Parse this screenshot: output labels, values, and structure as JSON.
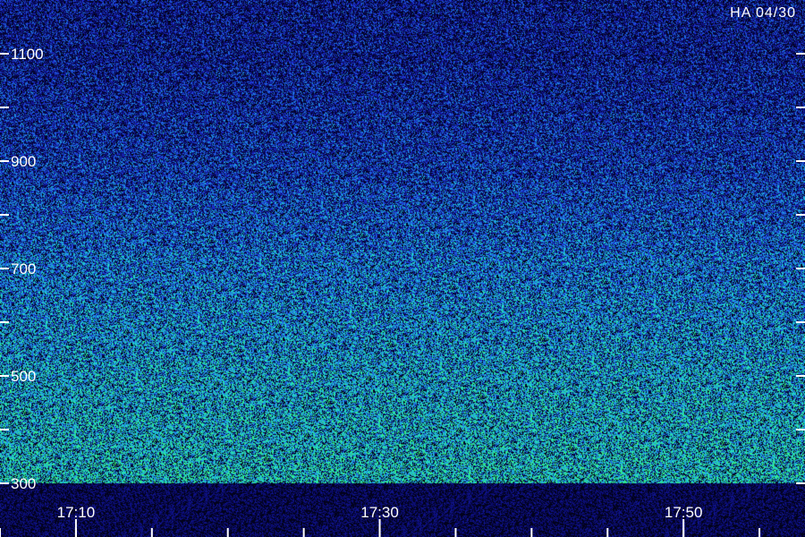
{
  "chart_data": {
    "type": "heatmap",
    "title": "",
    "corner_label": "HA 04/30",
    "xlabel": "",
    "ylabel": "",
    "x_ticks": [
      {
        "time": "17:10",
        "labeled": true
      },
      {
        "time": "17:30",
        "labeled": true
      },
      {
        "time": "17:50",
        "labeled": true
      }
    ],
    "x_minor_ticks": [
      "17:05",
      "17:10",
      "17:15",
      "17:20",
      "17:25",
      "17:30",
      "17:35",
      "17:40",
      "17:45",
      "17:50",
      "17:55"
    ],
    "x_range": [
      "17:05",
      "17:58"
    ],
    "y_ticks": [
      300,
      500,
      700,
      900,
      1100
    ],
    "y_minor_ticks": [
      400,
      600,
      800,
      1000
    ],
    "y_range": [
      300,
      1200
    ],
    "colormap": [
      "#000000",
      "#0a0a6e",
      "#1e2ed8",
      "#1f8ee6",
      "#1fe0c8",
      "#3cf06a"
    ],
    "intensity_profile": [
      {
        "y": 300,
        "level": 0.78
      },
      {
        "y": 500,
        "level": 0.7
      },
      {
        "y": 700,
        "level": 0.58
      },
      {
        "y": 900,
        "level": 0.42
      },
      {
        "y": 1100,
        "level": 0.32
      },
      {
        "y": 1200,
        "level": 0.3
      }
    ],
    "grid": false,
    "legend": "none"
  }
}
